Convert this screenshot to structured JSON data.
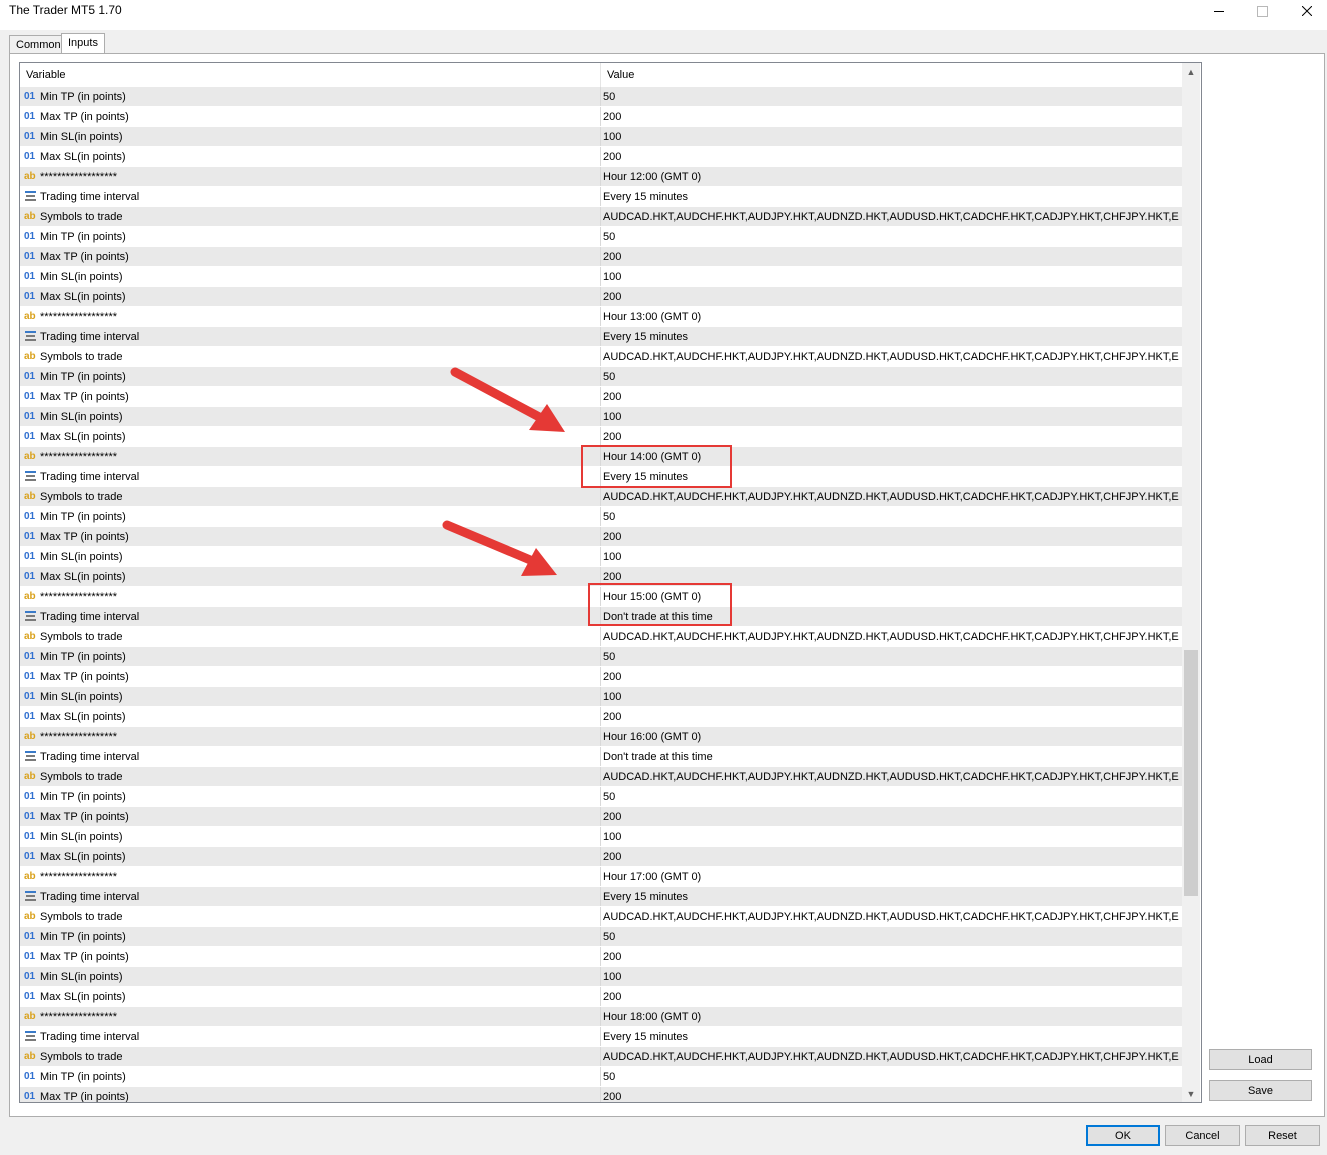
{
  "window": {
    "title": "The Trader MT5 1.70"
  },
  "tabs": [
    {
      "label": "Common"
    },
    {
      "label": "Inputs"
    }
  ],
  "grid": {
    "columns": {
      "variable": "Variable",
      "value": "Value"
    },
    "rows": [
      {
        "type": "num",
        "variable": "Min TP (in points)",
        "value": "50"
      },
      {
        "type": "num",
        "variable": "Max TP (in points)",
        "value": "200"
      },
      {
        "type": "num",
        "variable": "Min SL(in points)",
        "value": "100"
      },
      {
        "type": "num",
        "variable": "Max SL(in points)",
        "value": "200"
      },
      {
        "type": "str",
        "variable": "******************",
        "value": "Hour 12:00 (GMT 0)"
      },
      {
        "type": "enum",
        "variable": "Trading time interval",
        "value": "Every 15 minutes"
      },
      {
        "type": "str",
        "variable": "Symbols to trade",
        "value": "AUDCAD.HKT,AUDCHF.HKT,AUDJPY.HKT,AUDNZD.HKT,AUDUSD.HKT,CADCHF.HKT,CADJPY.HKT,CHFJPY.HKT,EURA..."
      },
      {
        "type": "num",
        "variable": "Min TP (in points)",
        "value": "50"
      },
      {
        "type": "num",
        "variable": "Max TP (in points)",
        "value": "200"
      },
      {
        "type": "num",
        "variable": "Min SL(in points)",
        "value": "100"
      },
      {
        "type": "num",
        "variable": "Max SL(in points)",
        "value": "200"
      },
      {
        "type": "str",
        "variable": "******************",
        "value": "Hour 13:00 (GMT 0)"
      },
      {
        "type": "enum",
        "variable": "Trading time interval",
        "value": "Every 15 minutes"
      },
      {
        "type": "str",
        "variable": "Symbols to trade",
        "value": "AUDCAD.HKT,AUDCHF.HKT,AUDJPY.HKT,AUDNZD.HKT,AUDUSD.HKT,CADCHF.HKT,CADJPY.HKT,CHFJPY.HKT,EURA..."
      },
      {
        "type": "num",
        "variable": "Min TP (in points)",
        "value": "50"
      },
      {
        "type": "num",
        "variable": "Max TP (in points)",
        "value": "200"
      },
      {
        "type": "num",
        "variable": "Min SL(in points)",
        "value": "100"
      },
      {
        "type": "num",
        "variable": "Max SL(in points)",
        "value": "200"
      },
      {
        "type": "str",
        "variable": "******************",
        "value": "Hour 14:00 (GMT 0)"
      },
      {
        "type": "enum",
        "variable": "Trading time interval",
        "value": "Every 15 minutes"
      },
      {
        "type": "str",
        "variable": "Symbols to trade",
        "value": "AUDCAD.HKT,AUDCHF.HKT,AUDJPY.HKT,AUDNZD.HKT,AUDUSD.HKT,CADCHF.HKT,CADJPY.HKT,CHFJPY.HKT,EURA..."
      },
      {
        "type": "num",
        "variable": "Min TP (in points)",
        "value": "50"
      },
      {
        "type": "num",
        "variable": "Max TP (in points)",
        "value": "200"
      },
      {
        "type": "num",
        "variable": "Min SL(in points)",
        "value": "100"
      },
      {
        "type": "num",
        "variable": "Max SL(in points)",
        "value": "200"
      },
      {
        "type": "str",
        "variable": "******************",
        "value": "Hour 15:00 (GMT 0)"
      },
      {
        "type": "enum",
        "variable": "Trading time interval",
        "value": "Don't trade at this time"
      },
      {
        "type": "str",
        "variable": "Symbols to trade",
        "value": "AUDCAD.HKT,AUDCHF.HKT,AUDJPY.HKT,AUDNZD.HKT,AUDUSD.HKT,CADCHF.HKT,CADJPY.HKT,CHFJPY.HKT,EURA..."
      },
      {
        "type": "num",
        "variable": "Min TP (in points)",
        "value": "50"
      },
      {
        "type": "num",
        "variable": "Max TP (in points)",
        "value": "200"
      },
      {
        "type": "num",
        "variable": "Min SL(in points)",
        "value": "100"
      },
      {
        "type": "num",
        "variable": "Max SL(in points)",
        "value": "200"
      },
      {
        "type": "str",
        "variable": "******************",
        "value": "Hour 16:00 (GMT 0)"
      },
      {
        "type": "enum",
        "variable": "Trading time interval",
        "value": "Don't trade at this time"
      },
      {
        "type": "str",
        "variable": "Symbols to trade",
        "value": "AUDCAD.HKT,AUDCHF.HKT,AUDJPY.HKT,AUDNZD.HKT,AUDUSD.HKT,CADCHF.HKT,CADJPY.HKT,CHFJPY.HKT,EURA..."
      },
      {
        "type": "num",
        "variable": "Min TP (in points)",
        "value": "50"
      },
      {
        "type": "num",
        "variable": "Max TP (in points)",
        "value": "200"
      },
      {
        "type": "num",
        "variable": "Min SL(in points)",
        "value": "100"
      },
      {
        "type": "num",
        "variable": "Max SL(in points)",
        "value": "200"
      },
      {
        "type": "str",
        "variable": "******************",
        "value": "Hour 17:00 (GMT 0)"
      },
      {
        "type": "enum",
        "variable": "Trading time interval",
        "value": "Every 15 minutes"
      },
      {
        "type": "str",
        "variable": "Symbols to trade",
        "value": "AUDCAD.HKT,AUDCHF.HKT,AUDJPY.HKT,AUDNZD.HKT,AUDUSD.HKT,CADCHF.HKT,CADJPY.HKT,CHFJPY.HKT,EURA..."
      },
      {
        "type": "num",
        "variable": "Min TP (in points)",
        "value": "50"
      },
      {
        "type": "num",
        "variable": "Max TP (in points)",
        "value": "200"
      },
      {
        "type": "num",
        "variable": "Min SL(in points)",
        "value": "100"
      },
      {
        "type": "num",
        "variable": "Max SL(in points)",
        "value": "200"
      },
      {
        "type": "str",
        "variable": "******************",
        "value": "Hour 18:00 (GMT 0)"
      },
      {
        "type": "enum",
        "variable": "Trading time interval",
        "value": "Every 15 minutes"
      },
      {
        "type": "str",
        "variable": "Symbols to trade",
        "value": "AUDCAD.HKT,AUDCHF.HKT,AUDJPY.HKT,AUDNZD.HKT,AUDUSD.HKT,CADCHF.HKT,CADJPY.HKT,CHFJPY.HKT,EURA..."
      },
      {
        "type": "num",
        "variable": "Min TP (in points)",
        "value": "50"
      },
      {
        "type": "num",
        "variable": "Max TP (in points)",
        "value": "200"
      }
    ]
  },
  "icons": {
    "num": "01",
    "str": "ab",
    "enum": "enum-list-icon"
  },
  "buttons": {
    "load": "Load",
    "save": "Save",
    "ok": "OK",
    "cancel": "Cancel",
    "reset": "Reset"
  },
  "annotations": {
    "color": "#e53935"
  }
}
